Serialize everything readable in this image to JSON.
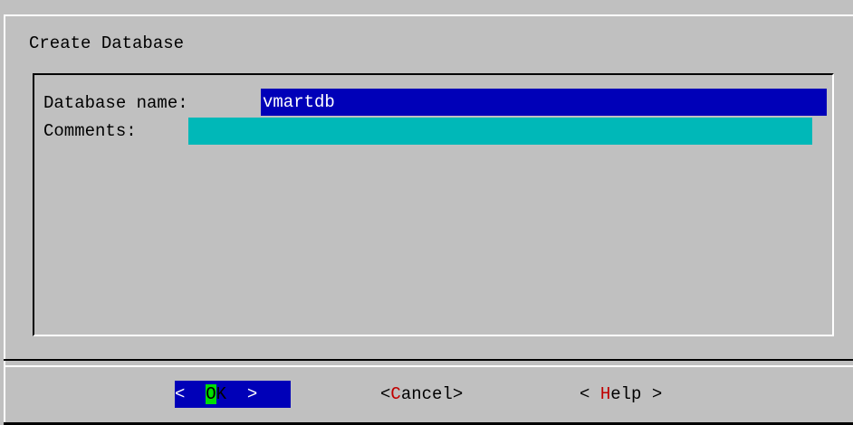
{
  "dialog": {
    "title": "Create Database"
  },
  "form": {
    "name_label": "Database name:",
    "name_value": "vmartdb",
    "comments_label": "Comments:",
    "comments_value": ""
  },
  "buttons": {
    "ok": {
      "left": "<  ",
      "hotkey": "O",
      "rest": "K",
      "right": "  >"
    },
    "cancel": {
      "left": "<",
      "hotkey": "C",
      "rest": "ancel>"
    },
    "help": {
      "left": "< ",
      "hotkey": "H",
      "rest": "elp >"
    }
  },
  "colors": {
    "background": "#c0c0c0",
    "field_active": "#0000b8",
    "field_inactive": "#00b8b8",
    "hotkey_focus": "#00e000",
    "hotkey": "#c00000"
  }
}
